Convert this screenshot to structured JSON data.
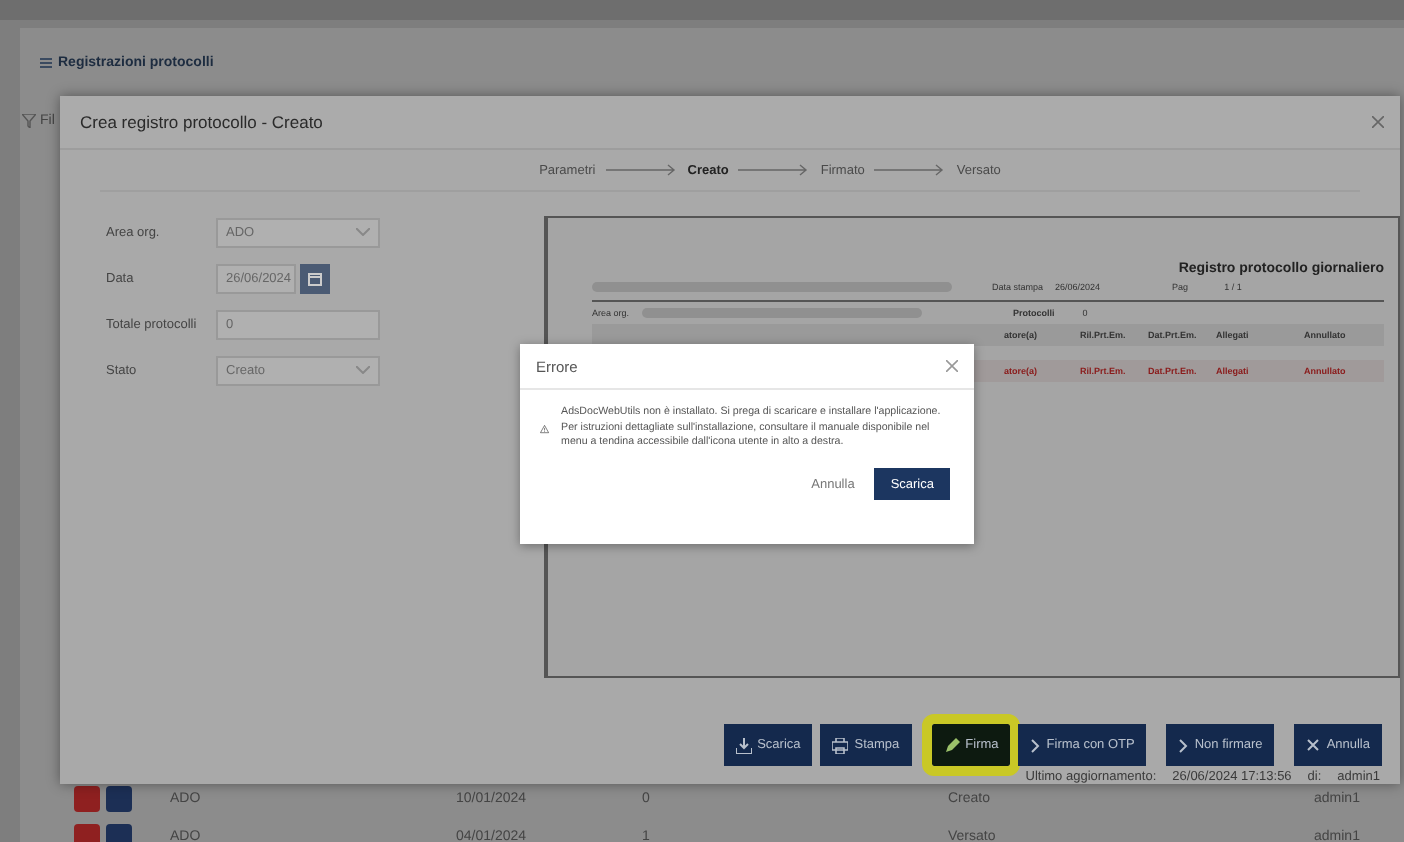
{
  "page": {
    "title": "Registrazioni protocolli",
    "filter_label": "Fil",
    "list_rows": [
      {
        "kind": "hidden"
      },
      {
        "kind": "hidden"
      },
      {
        "kind": "hidden"
      },
      {
        "kind": "hidden"
      },
      {
        "kind": "hidden"
      },
      {
        "kind": "hidden"
      },
      {
        "kind": "hidden"
      },
      {
        "kind": "hidden"
      },
      {
        "kind": "hidden"
      },
      {
        "kind": "hidden"
      },
      {
        "kind": "hidden"
      },
      {
        "kind": "hidden"
      },
      {
        "kind": "hidden"
      },
      {
        "kind": "hidden"
      },
      {
        "kind": "full",
        "cells": [
          "ADO",
          "10/01/2024",
          "0",
          "Creato",
          "admin1"
        ]
      },
      {
        "kind": "full",
        "cells": [
          "ADO",
          "04/01/2024",
          "1",
          "Versato",
          "admin1"
        ]
      }
    ]
  },
  "modal": {
    "title": "Crea registro protocollo - Creato",
    "steps": [
      {
        "label": "Parametri",
        "selected": false
      },
      {
        "label": "Creato",
        "selected": true
      },
      {
        "label": "Firmato",
        "selected": false
      },
      {
        "label": "Versato",
        "selected": false
      }
    ],
    "fields": [
      {
        "kind": "select",
        "label": "Area org.",
        "value": "ADO"
      },
      {
        "kind": "date",
        "label": "Data",
        "value": "26/06/2024"
      },
      {
        "kind": "text",
        "label": "Totale protocolli",
        "value": "0"
      },
      {
        "kind": "select",
        "label": "Stato",
        "value": "Creato"
      }
    ],
    "preview": {
      "title": "Registro protocollo giornaliero",
      "print_label": "Data stampa",
      "print_date": "26/06/2024",
      "page_label": "Pag",
      "page_value": "1 / 1",
      "area_label": "Area org.",
      "count_label": "Protocolli",
      "count_value": "0",
      "header": [
        "atore(a)",
        "Ril.Prt.Em.",
        "Dat.Prt.Em.",
        "Allegati",
        "Annullato"
      ],
      "rows": [
        [
          "atore(a)",
          "Ril.Prt.Em.",
          "Dat.Prt.Em.",
          "Allegati",
          "Annullato"
        ]
      ]
    },
    "buttons": [
      {
        "kind": "download",
        "label": "Scarica",
        "highlighted": false
      },
      {
        "kind": "print",
        "label": "Stampa",
        "highlighted": false
      },
      {
        "kind": "sign",
        "label": "Firma",
        "highlighted": true
      },
      {
        "kind": "next",
        "label": "Firma con OTP",
        "highlighted": false
      },
      {
        "kind": "next",
        "label": "Non firmare",
        "highlighted": false
      },
      {
        "kind": "cancel",
        "label": "Annulla",
        "highlighted": false
      }
    ],
    "footer": {
      "label": "Ultimo aggiornamento:",
      "timestamp": "26/06/2024 17:13:56",
      "by_label": "di:",
      "user": "admin1"
    }
  },
  "dialog": {
    "title": "Errore",
    "message": "AdsDocWebUtils non è installato. Si prega di scaricare e installare l'applicazione. Per istruzioni dettagliate sull'installazione, consultare il manuale disponibile nel menu a tendina accessibile dall'icona utente in alto a destra.",
    "buttons": [
      {
        "kind": "link",
        "label": "Annulla"
      },
      {
        "kind": "primary",
        "label": "Scarica"
      }
    ]
  }
}
